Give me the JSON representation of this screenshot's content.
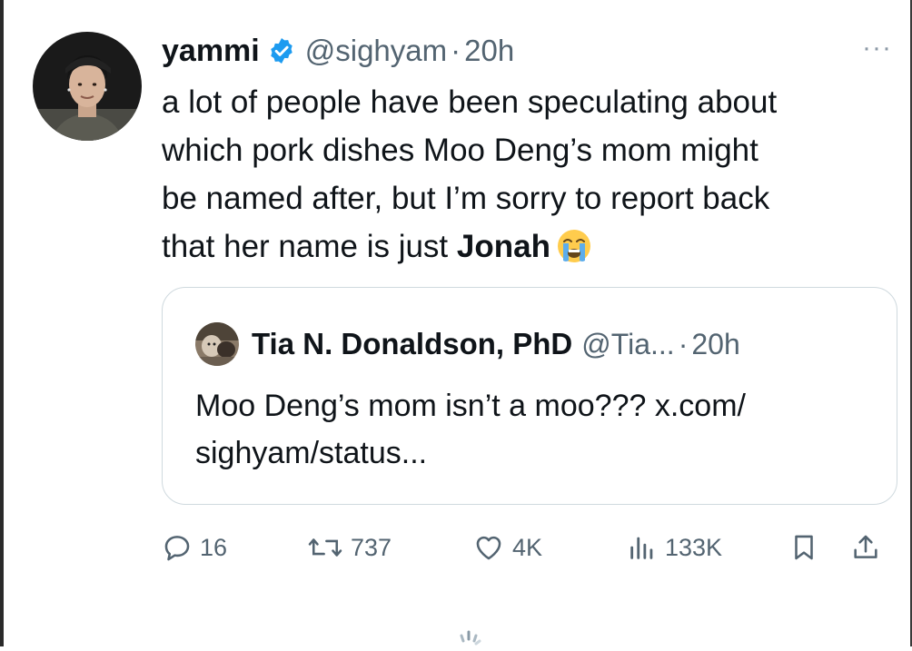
{
  "tweet": {
    "author_name": "yammi",
    "handle": "@sighyam",
    "separator": "·",
    "time": "20h",
    "more_label": "···",
    "text_lines": [
      "a lot of people have been speculating about",
      "which pork dishes Moo Deng’s mom might",
      "be named after, but I’m sorry to report back"
    ],
    "text_last_prefix": "that her name is just ",
    "text_bold": "Jonah",
    "emoji": "loudly-crying-face-emoji"
  },
  "quote": {
    "author_name": "Tia N. Donaldson, PhD",
    "handle": "@Tia...",
    "separator": "·",
    "time": "20h",
    "text_line_1": "Moo Deng’s mom isn’t a moo??? x.com/",
    "text_line_2": "sighyam/status..."
  },
  "actions": {
    "replies": "16",
    "reposts": "737",
    "likes": "4K",
    "views": "133K"
  },
  "icons": {
    "verified": "verified-badge-icon",
    "reply": "reply-icon",
    "repost": "repost-icon",
    "like": "heart-icon",
    "views": "views-icon",
    "bookmark": "bookmark-icon",
    "share": "share-icon"
  },
  "colors": {
    "verified_blue": "#1d9bf0",
    "text_primary": "#0f1419",
    "text_secondary": "#536471",
    "border": "#cfd9de"
  }
}
